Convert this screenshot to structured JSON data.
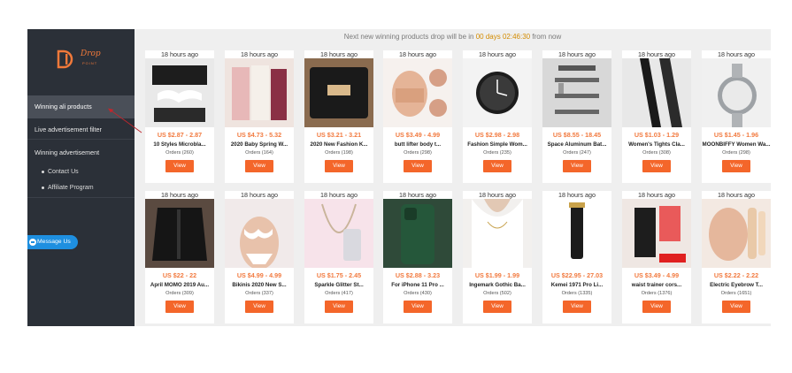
{
  "brand": {
    "name": "Drop",
    "sub": "POINT"
  },
  "sidebar": {
    "items": [
      {
        "label": "Winning ali products"
      },
      {
        "label": "Live advertisement filter"
      },
      {
        "label": "Winning advertisement"
      }
    ],
    "subitems": [
      {
        "label": "Contact Us"
      },
      {
        "label": "Affiliate Program"
      }
    ],
    "message_button": "Message Us"
  },
  "banner": {
    "prefix": "Next new winning products drop will be in",
    "countdown": "00 days 02:46:30",
    "suffix": "from now"
  },
  "colors": {
    "accent": "#f4662a",
    "price": "#f27a3f",
    "sidebar": "#2b3038",
    "messenger": "#1e8fe0"
  },
  "products": [
    {
      "time": "18 hours ago",
      "price": "US $2.87 - 2.87",
      "title": "10 Styles Microbla...",
      "orders": "Orders (260)",
      "button": "View"
    },
    {
      "time": "18 hours ago",
      "price": "US $4.73 - 5.32",
      "title": "2020 Baby Spring W...",
      "orders": "Orders (164)",
      "button": "View"
    },
    {
      "time": "18 hours ago",
      "price": "US $3.21 - 3.21",
      "title": "2020 New Fashion K...",
      "orders": "Orders (198)",
      "button": "View"
    },
    {
      "time": "18 hours ago",
      "price": "US $3.49 - 4.99",
      "title": "butt lifter body t...",
      "orders": "Orders (298)",
      "button": "View"
    },
    {
      "time": "18 hours ago",
      "price": "US $2.98 - 2.98",
      "title": "Fashion Simple Wom...",
      "orders": "Orders (235)",
      "button": "View"
    },
    {
      "time": "18 hours ago",
      "price": "US $8.55 - 18.45",
      "title": "Space Aluminum Bat...",
      "orders": "Orders (247)",
      "button": "View"
    },
    {
      "time": "18 hours ago",
      "price": "US $1.03 - 1.29",
      "title": "Women's Tights Cla...",
      "orders": "Orders (308)",
      "button": "View"
    },
    {
      "time": "18 hours ago",
      "price": "US $1.45 - 1.96",
      "title": "MOONBIFFY Women Wa...",
      "orders": "Orders (298)",
      "button": "View"
    },
    {
      "time": "18 hours ago",
      "price": "US $22 - 22",
      "title": "April MOMO 2019 Au...",
      "orders": "Orders (309)",
      "button": "View"
    },
    {
      "time": "18 hours ago",
      "price": "US $4.99 - 4.99",
      "title": "Bikinis 2020 New S...",
      "orders": "Orders (337)",
      "button": "View"
    },
    {
      "time": "18 hours ago",
      "price": "US $1.75 - 2.45",
      "title": "Sparkle Glitter St...",
      "orders": "Orders (417)",
      "button": "View"
    },
    {
      "time": "18 hours ago",
      "price": "US $2.88 - 3.23",
      "title": "For iPhone 11 Pro ...",
      "orders": "Orders (430)",
      "button": "View"
    },
    {
      "time": "18 hours ago",
      "price": "US $1.99 - 1.99",
      "title": "Ingemark Gothic Ba...",
      "orders": "Orders (502)",
      "button": "View"
    },
    {
      "time": "18 hours ago",
      "price": "US $22.95 - 27.03",
      "title": "Kemei 1971 Pro Li...",
      "orders": "Orders (1335)",
      "button": "View"
    },
    {
      "time": "18 hours ago",
      "price": "US $3.49 - 4.99",
      "title": "waist trainer cors...",
      "orders": "Orders (1376)",
      "button": "View"
    },
    {
      "time": "18 hours ago",
      "price": "US $2.22 - 2.22",
      "title": "Electric Eyebrow T...",
      "orders": "Orders (1651)",
      "button": "View"
    }
  ]
}
